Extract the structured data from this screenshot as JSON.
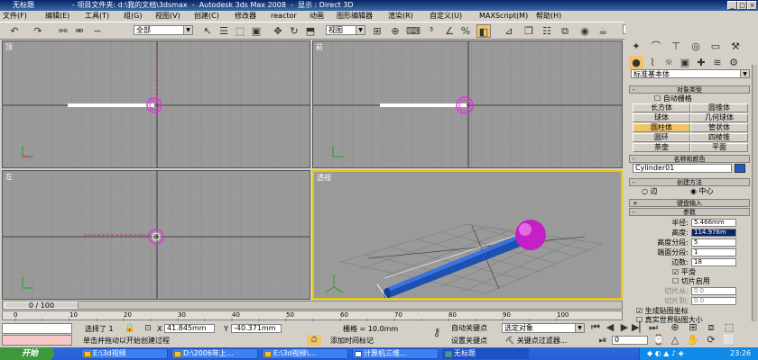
{
  "title": {
    "doc": "无标题",
    "sep": "-",
    "project": "项目文件夹: d:\\我的文档\\3dsmax",
    "sep2": "-",
    "app": "Autodesk 3ds Max 2008",
    "sep3": "-",
    "display": "显示 : Direct 3D"
  },
  "menu": [
    "文件(F)",
    "编辑(E)",
    "工具(T)",
    "组(G)",
    "视图(V)",
    "创建(C)",
    "修改器",
    "reactor",
    "动画",
    "图形编辑器",
    "渲染(R)",
    "自定义(U)",
    "MAXScript(M)",
    "帮助(H)"
  ],
  "toolbar": {
    "selection_filter": "全部",
    "ref_coord": "视图"
  },
  "viewports": {
    "top": "顶",
    "front": "前",
    "left": "左",
    "persp": "透视"
  },
  "cmd": {
    "category": "标准基本体",
    "object_type": "对象类型",
    "autogrid": "自动栅格",
    "objects": [
      "长方体",
      "圆锥体",
      "球体",
      "几何球体",
      "圆柱体",
      "管状体",
      "圆环",
      "四棱锥",
      "茶壶",
      "平面"
    ],
    "name_color": "名称和颜色",
    "name_value": "Cylinder01",
    "create_method": "创建方法",
    "edge": "边",
    "center": "中心",
    "keyboard": "键盘输入",
    "params": "参数",
    "radius_l": "半径:",
    "radius_v": "5.466mm",
    "height_l": "高度:",
    "height_v": "114.976m",
    "hseg_l": "高度分段:",
    "hseg_v": "5",
    "cseg_l": "端面分段:",
    "cseg_v": "1",
    "sides_l": "边数:",
    "sides_v": "18",
    "smooth": "平滑",
    "slice_on": "切片启用",
    "slice_from_l": "切片从:",
    "slice_from_v": "0.0",
    "slice_to_l": "切片到:",
    "slice_to_v": "0.0",
    "gen_map": "生成贴图坐标",
    "real_world": "真实世界贴图大小"
  },
  "timeline": {
    "frame": "0 / 100",
    "ticks": [
      "0",
      "10",
      "20",
      "30",
      "40",
      "50",
      "60",
      "70",
      "80",
      "90",
      "100"
    ]
  },
  "status": {
    "selected": "选择了 1",
    "x_l": "X",
    "x_v": "41.845mm",
    "y_l": "Y",
    "y_v": "-40.371mm",
    "grid": "栅格 = 10.0mm",
    "prompt": "单击并拖动以开始创建过程",
    "add_time": "添加时间标记",
    "auto_key": "自动关键点",
    "set_key": "设置关键点",
    "sel_obj": "选定对象",
    "key_filter": "关键点过滤器...",
    "frame_v": "0"
  },
  "taskbar": {
    "start": "开始",
    "tasks": [
      "E:\\3d视频",
      "D:\\2006年上...",
      "E:\\3d视频\\...",
      "计算机三维...",
      "无标题"
    ],
    "time": "23:26"
  }
}
